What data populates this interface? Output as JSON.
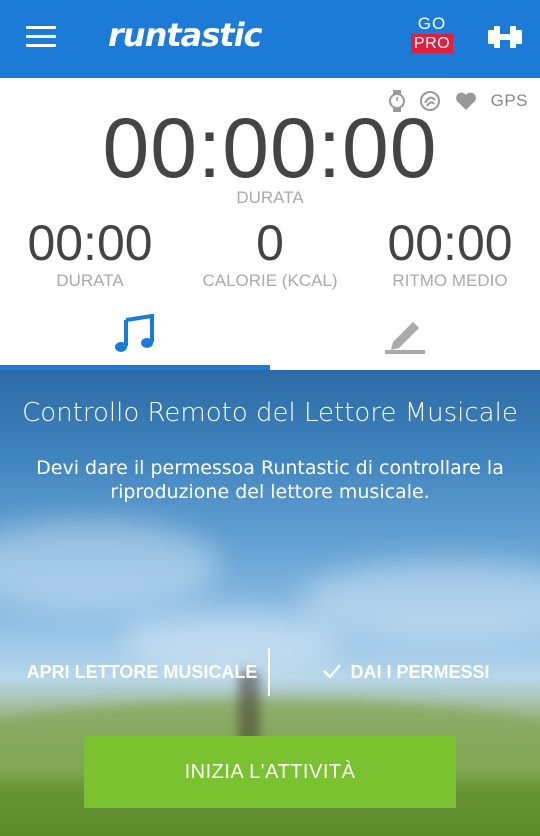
{
  "appbar": {
    "logo_text": "runtastic",
    "gopro": {
      "go": "GO",
      "pro": "PRO"
    },
    "pro_badge_color": "#e01f3d",
    "accent": "#1b7bd6",
    "icons": [
      "menu-icon",
      "dumbbell-icon"
    ]
  },
  "status": {
    "icons": [
      "watch-icon",
      "running-track-icon",
      "heart-icon"
    ],
    "gps_label": "GPS"
  },
  "timer": {
    "value": "00:00:00",
    "label": "DURATA"
  },
  "stats": [
    {
      "value": "00:00",
      "label": "DURATA"
    },
    {
      "value": "0",
      "label": "CALORIE (KCAL)"
    },
    {
      "value": "00:00",
      "label": "RITMO MEDIO"
    }
  ],
  "tabs": [
    {
      "icon": "music-note-icon",
      "active": true
    },
    {
      "icon": "pencil-icon",
      "active": false
    }
  ],
  "panel": {
    "title": "Controllo Remoto del Lettore Musicale",
    "description": "Devi dare il permessoa Runtastic di controllare la riproduzione del lettore musicale.",
    "open_player_label": "APRI LETTORE MUSICALE",
    "grant_label": "DAI I PERMESSI"
  },
  "start_button": {
    "label": "INIZIA L'ATTIVITÀ",
    "color": "#7ac22f"
  }
}
